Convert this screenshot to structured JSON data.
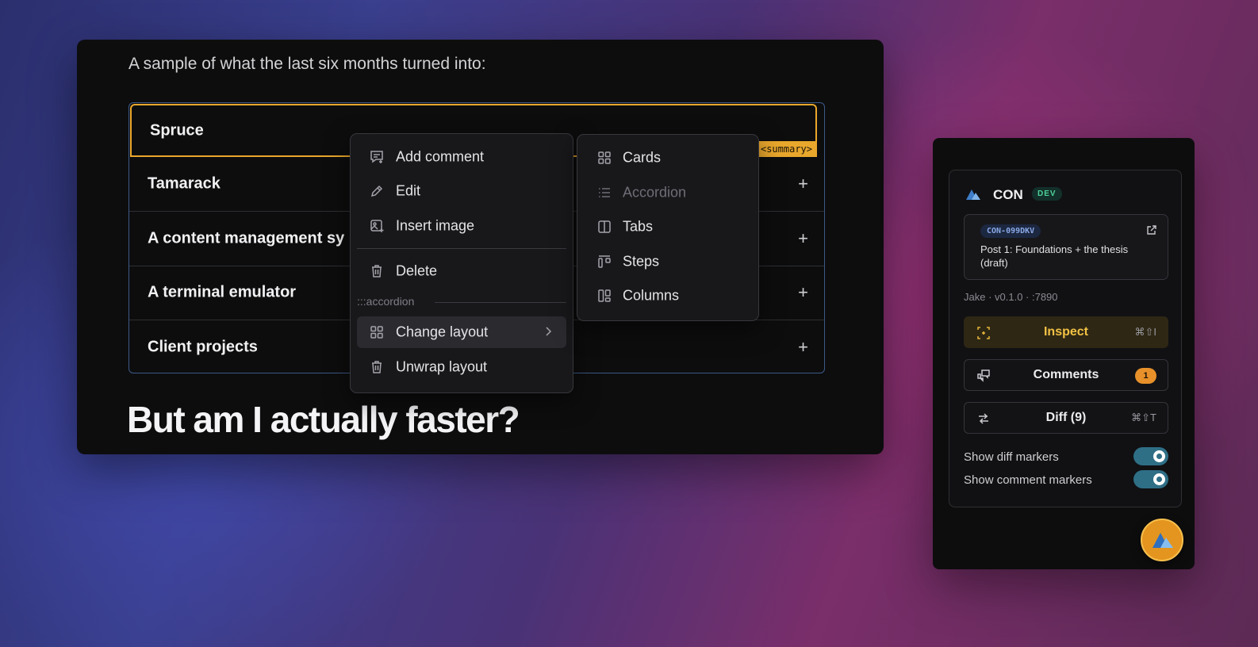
{
  "doc": {
    "intro": "A sample of what the last six months turned into:",
    "accordion": [
      {
        "label": "Spruce",
        "plus": "+"
      },
      {
        "label": "Tamarack",
        "plus": "+"
      },
      {
        "label": "A content management sy",
        "plus": "+"
      },
      {
        "label": "A terminal emulator",
        "plus": "+"
      },
      {
        "label": "Client projects",
        "plus": "+"
      }
    ],
    "summary_tag": "<summary>",
    "heading": "But am I actually faster?"
  },
  "context_menu": {
    "items": [
      {
        "label": "Add comment",
        "icon": "comment-add-icon"
      },
      {
        "label": "Edit",
        "icon": "pencil-icon"
      },
      {
        "label": "Insert image",
        "icon": "image-add-icon"
      },
      {
        "label": "Delete",
        "icon": "trash-icon"
      }
    ],
    "section_label": ":::accordion",
    "section_items": [
      {
        "label": "Change layout",
        "icon": "grid-icon"
      },
      {
        "label": "Unwrap layout",
        "icon": "trash-icon"
      }
    ]
  },
  "layout_submenu": {
    "items": [
      {
        "label": "Cards",
        "icon": "grid-icon",
        "disabled": false
      },
      {
        "label": "Accordion",
        "icon": "list-icon",
        "disabled": true
      },
      {
        "label": "Tabs",
        "icon": "columns-icon",
        "disabled": false
      },
      {
        "label": "Steps",
        "icon": "steps-icon",
        "disabled": false
      },
      {
        "label": "Columns",
        "icon": "columns-layout-icon",
        "disabled": false
      }
    ]
  },
  "panel": {
    "app_name": "CON",
    "env_badge": "DEV",
    "issue_id": "CON-099DKV",
    "issue_title": "Post 1: Foundations + the thesis (draft)",
    "meta": "Jake · v0.1.0 · :7890",
    "inspect": {
      "label": "Inspect",
      "shortcut": "⌘⇧I"
    },
    "comments": {
      "label": "Comments",
      "count": "1"
    },
    "diff": {
      "label": "Diff (9)",
      "shortcut": "⌘⇧T"
    },
    "toggles": [
      {
        "label": "Show diff markers",
        "on": true
      },
      {
        "label": "Show comment markers",
        "on": true
      }
    ]
  },
  "colors": {
    "accent_gold": "#e9a72c",
    "border_blue": "#3d5a88",
    "toggle_teal": "#2e6f86",
    "badge_orange": "#e8912a"
  }
}
